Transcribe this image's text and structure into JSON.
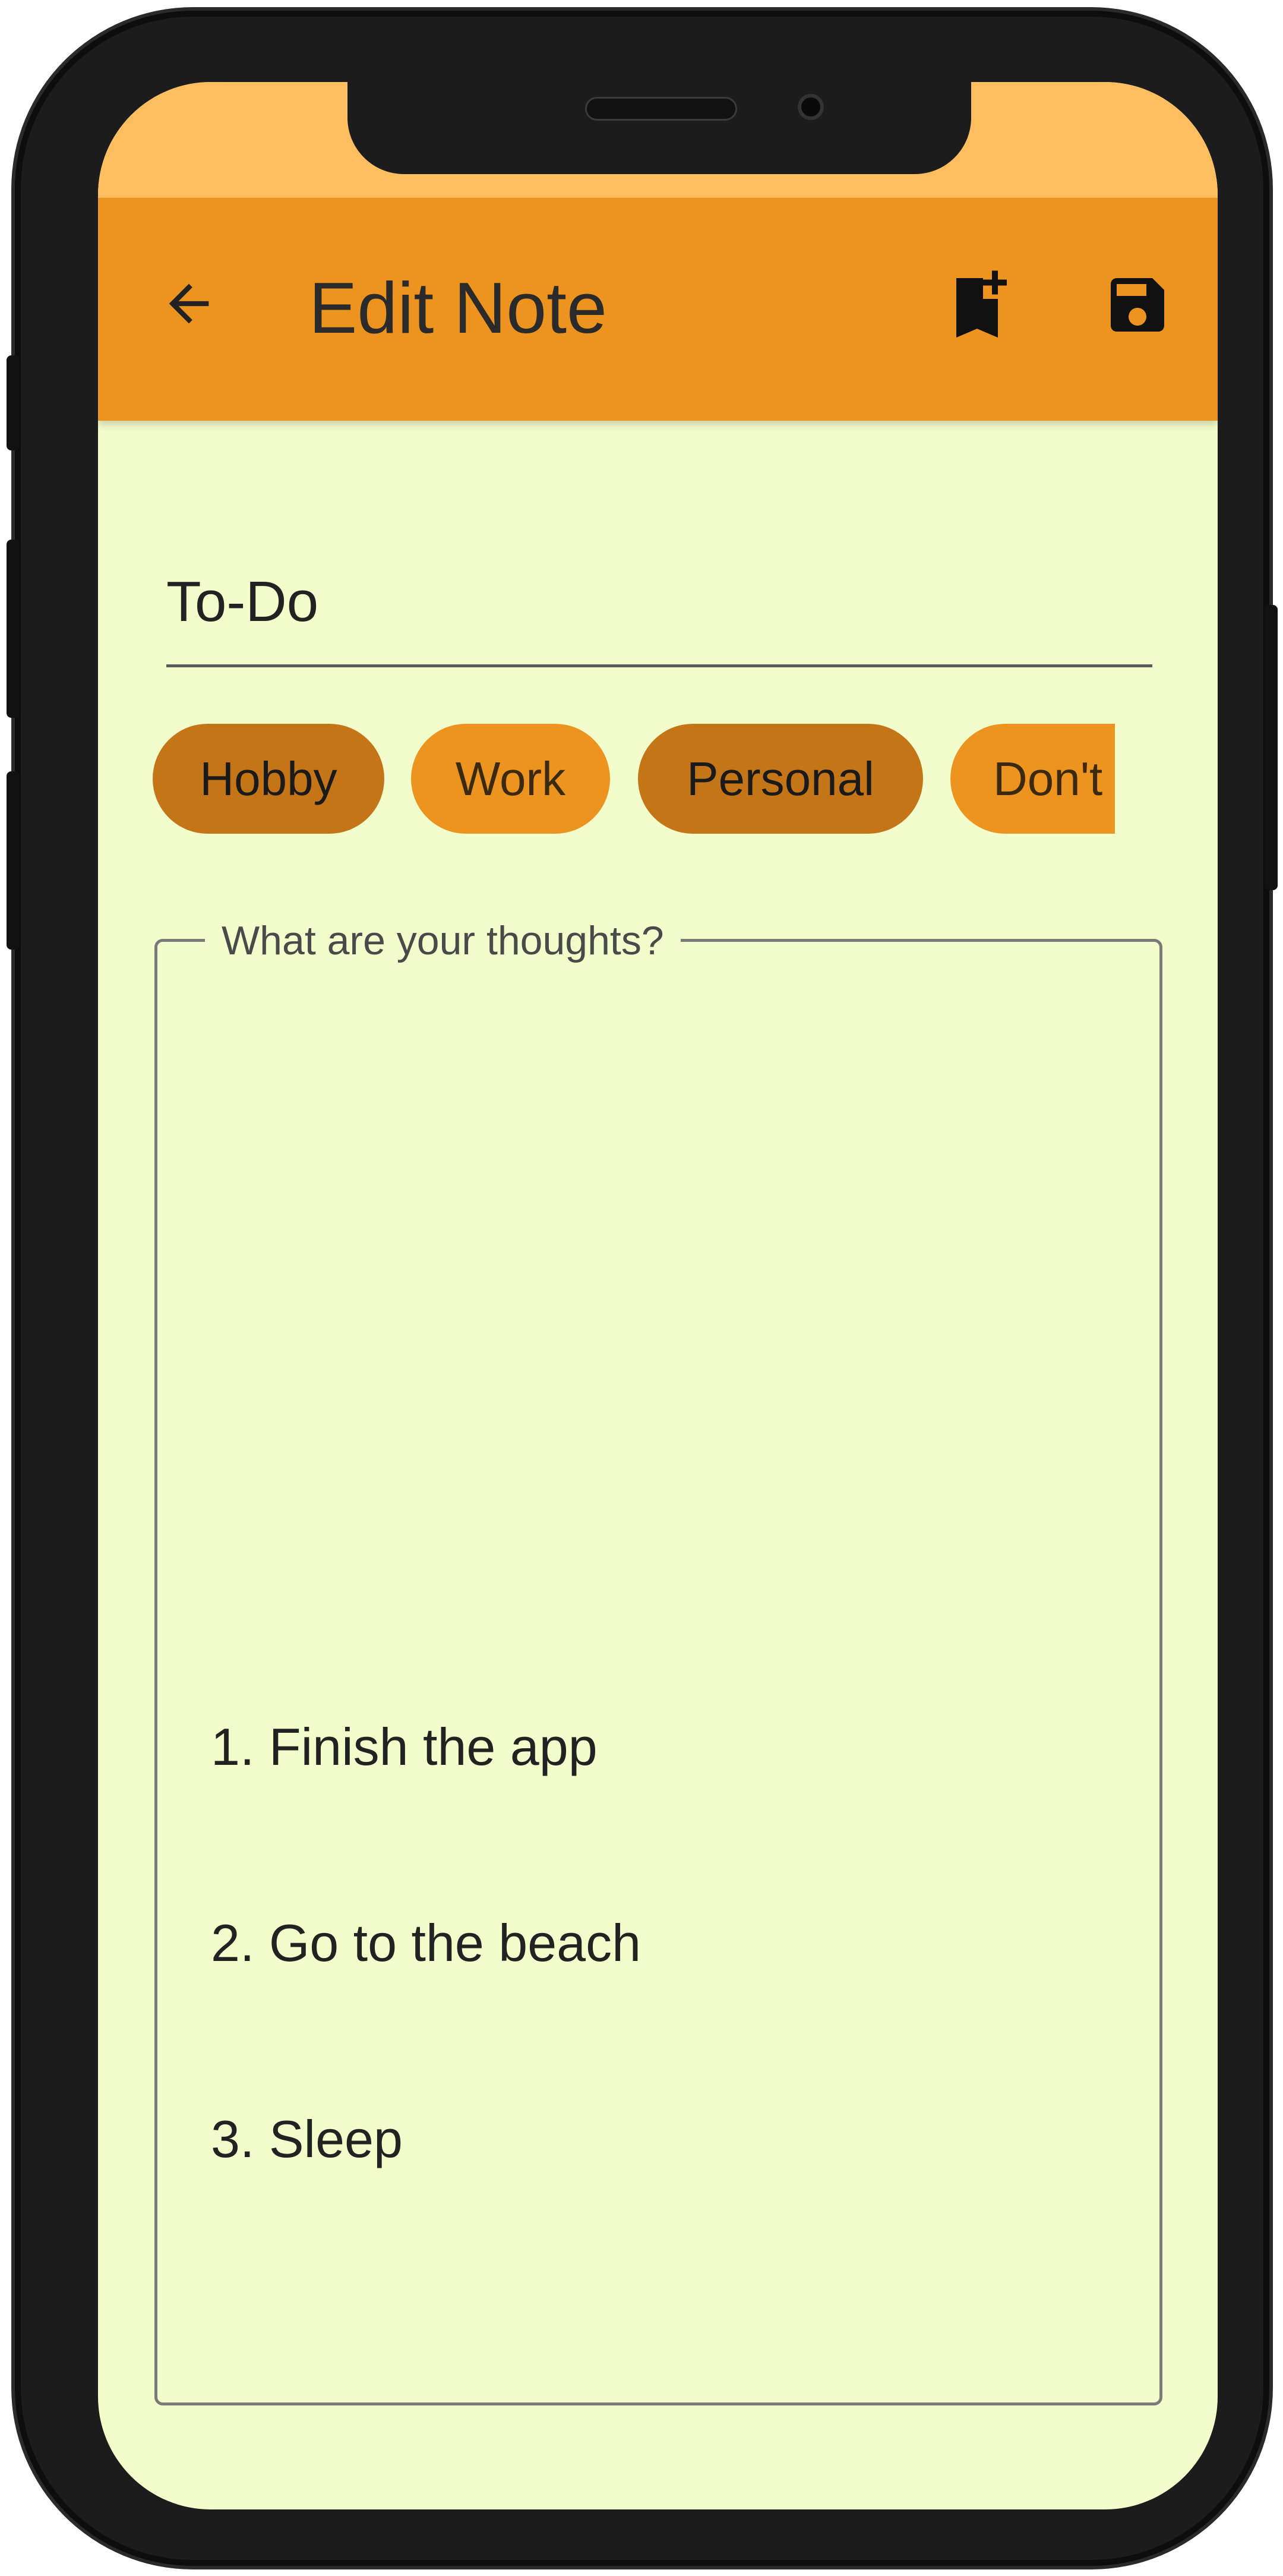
{
  "appbar": {
    "title": "Edit Note",
    "back_icon": "arrow-back-icon",
    "bookmark_icon": "bookmark-add-icon",
    "save_icon": "save-icon"
  },
  "note": {
    "title_value": "To-Do",
    "body_label": "What are your thoughts?",
    "body_lines": [
      "1. Finish the app",
      "2. Go to the beach",
      "3. Sleep"
    ]
  },
  "chips": [
    {
      "label": "Hobby",
      "selected": true
    },
    {
      "label": "Work",
      "selected": false
    },
    {
      "label": "Personal",
      "selected": true
    },
    {
      "label": "Don't Fo",
      "selected": false
    }
  ],
  "colors": {
    "appbar": "#EC941F",
    "status_bar": "#FCBE5E",
    "background": "#F3FCCB",
    "chip_selected": "#C37518",
    "chip_unselected": "#EC941F"
  }
}
